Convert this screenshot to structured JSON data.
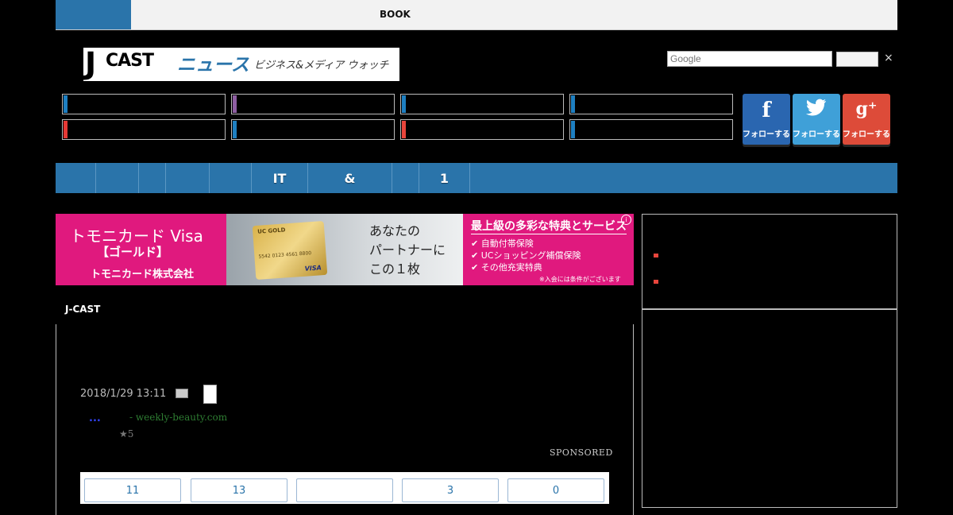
{
  "topbar": {
    "book_label": "BOOK"
  },
  "logo": {
    "j": "J",
    "cast": "CAST",
    "news": "ニュース",
    "subtitle": "ビジネス&メディア ウォッチ"
  },
  "search": {
    "placeholder": "Google",
    "clear_symbol": "×"
  },
  "categories": {
    "colors": [
      "#1e7fc1",
      "#8e5ea2",
      "#1e7fc1",
      "#1e7fc1",
      "#e53935",
      "#1e7fc1",
      "#e8453c",
      "#1e7fc1"
    ]
  },
  "social": {
    "facebook": {
      "icon": "f",
      "label": "フォローする",
      "color": "#2a66b0"
    },
    "twitter": {
      "icon": "🐦",
      "label": "フォローする",
      "color": "#3fa0d8"
    },
    "google": {
      "icon": "g⁺",
      "label": "フォローする",
      "color": "#dd4b39"
    }
  },
  "nav": {
    "items": [
      "",
      "",
      "",
      "",
      "",
      "IT",
      "&",
      "",
      "1"
    ]
  },
  "ad": {
    "left_title": "トモニカード Visa",
    "left_sub": "【ゴールド】",
    "left_company": "トモニカード株式会社",
    "card_brand": "UC GOLD",
    "card_number": "5542 0123 4561 8800",
    "card_visa": "VISA",
    "copy_line1": "あなたの",
    "copy_line2": "パートナーに",
    "copy_line3": "この１枚",
    "right_title": "最上級の多彩な特典とサービス",
    "features": [
      "自動付帯保険",
      "UCショッピング補償保険",
      "その他充実特典"
    ],
    "note": "※入会には条件がございます",
    "info_icon": "i"
  },
  "article": {
    "label": "J-CAST",
    "date": "2018/1/29 13:11",
    "sponsored_dots": "...",
    "sponsored_domain": "- weekly-beauty.com",
    "sponsored_rating": "★5",
    "sponsored_label": "SPONSORED",
    "counts": [
      "11",
      "13",
      "",
      "3",
      "0"
    ]
  },
  "colors": {
    "brand_blue": "#2a74aa",
    "ad_pink": "#e0197e"
  }
}
